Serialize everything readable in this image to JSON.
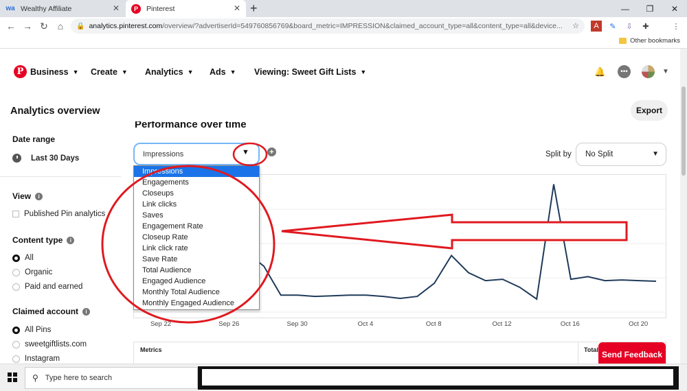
{
  "browser": {
    "tabs": [
      {
        "title": "Wealthy Affiliate",
        "favicon": "wa-icon",
        "active": false
      },
      {
        "title": "Pinterest",
        "favicon": "pinterest-icon",
        "active": true
      }
    ],
    "url_domain": "analytics.pinterest.com",
    "url_path": "/overview/?advertiserId=549760856769&board_metric=IMPRESSION&claimed_account_type=all&content_type=all&device...",
    "other_bookmarks": "Other bookmarks"
  },
  "header": {
    "logo": "P",
    "nav": [
      "Business",
      "Create",
      "Analytics",
      "Ads",
      "Viewing: Sweet Gift Lists"
    ]
  },
  "page": {
    "title": "Analytics overview",
    "export_label": "Export"
  },
  "sidebar": {
    "date_range_heading": "Date range",
    "date_range_value": "Last 30 Days",
    "view_heading": "View",
    "view_option": "Published Pin analytics",
    "content_type_heading": "Content type",
    "content_type_options": [
      "All",
      "Organic",
      "Paid and earned"
    ],
    "content_type_selected": "All",
    "claimed_account_heading": "Claimed account",
    "claimed_account_options": [
      "All Pins",
      "sweetgiftlists.com",
      "Instagram"
    ],
    "claimed_account_selected": "All Pins"
  },
  "main": {
    "section_title": "Performance over time",
    "metric_select_value": "Impressions",
    "split_label": "Split by",
    "split_value": "No Split",
    "metric_options": [
      "Impressions",
      "Engagements",
      "Closeups",
      "Link clicks",
      "Saves",
      "Engagement Rate",
      "Closeup Rate",
      "Link click rate",
      "Save Rate",
      "Total Audience",
      "Engaged Audience",
      "Monthly Total Audience",
      "Monthly Engaged Audience"
    ],
    "metric_selected": "Impressions",
    "table_metrics_header": "Metrics",
    "table_total_header": "Total",
    "feedback_label": "Send Feedback"
  },
  "chart_data": {
    "type": "line",
    "title": "",
    "xlabel": "",
    "ylabel": "",
    "x_ticks": [
      "Sep 22",
      "Sep 26",
      "Sep 30",
      "Oct 4",
      "Oct 8",
      "Oct 12",
      "Oct 16",
      "Oct 20"
    ],
    "x": [
      "Sep 22",
      "Sep 23",
      "Sep 24",
      "Sep 25",
      "Sep 26",
      "Sep 27",
      "Sep 28",
      "Sep 29",
      "Sep 30",
      "Oct 1",
      "Oct 2",
      "Oct 3",
      "Oct 4",
      "Oct 5",
      "Oct 6",
      "Oct 7",
      "Oct 8",
      "Oct 9",
      "Oct 10",
      "Oct 11",
      "Oct 12",
      "Oct 13",
      "Oct 14",
      "Oct 15",
      "Oct 16",
      "Oct 17",
      "Oct 18",
      "Oct 19",
      "Oct 20",
      "Oct 21"
    ],
    "series": [
      {
        "values": [
          48,
          50,
          52,
          49,
          52,
          48,
          38,
          16,
          16,
          15,
          15.5,
          16,
          16,
          15,
          13.5,
          15,
          25,
          46,
          33,
          27,
          28,
          22,
          13,
          100,
          28,
          30,
          27,
          27.5,
          27,
          26.5
        ]
      }
    ],
    "ylim": [
      0,
      105
    ],
    "grid": true,
    "line_color": "#1f3a5a"
  },
  "taskbar": {
    "search_placeholder": "Type here to search"
  },
  "annotations": {
    "color": "#e0191f"
  }
}
